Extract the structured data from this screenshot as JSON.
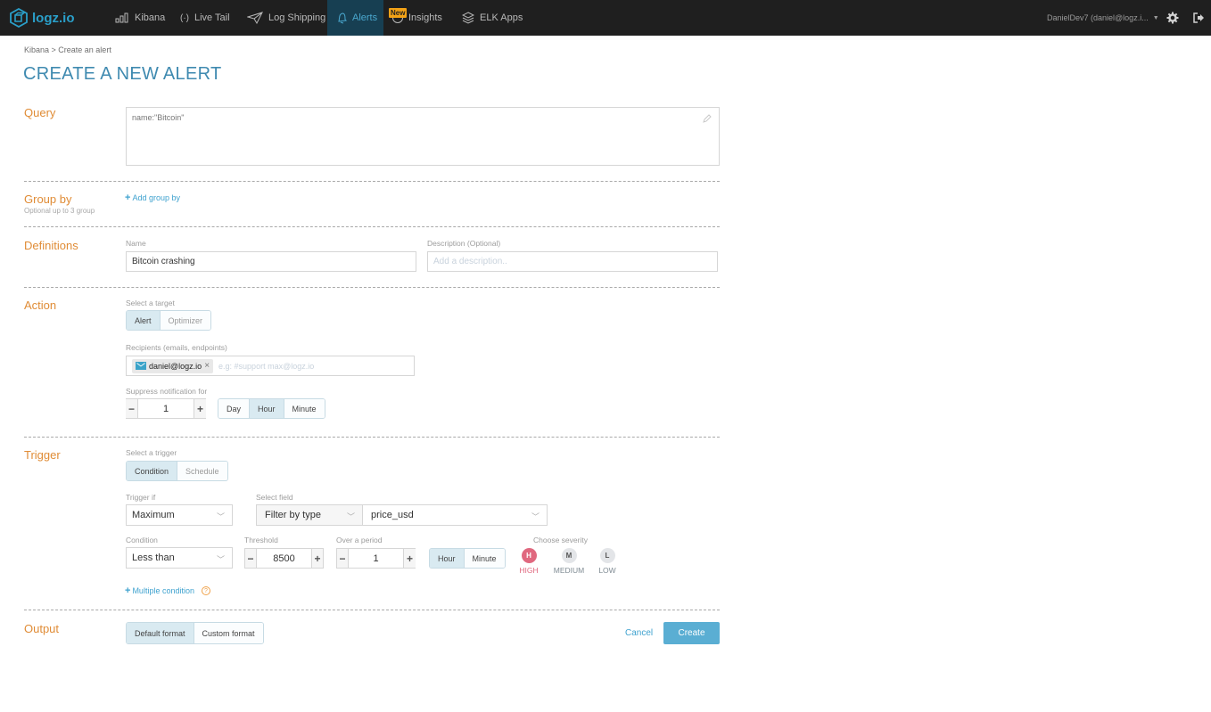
{
  "topbar": {
    "logo_text": "logz.io",
    "nav": [
      {
        "label": "Kibana",
        "icon": "bar-chart-icon"
      },
      {
        "label": "Live Tail",
        "icon": "broadcast-icon"
      },
      {
        "label": "Log Shipping",
        "icon": "paper-plane-icon"
      },
      {
        "label": "Alerts",
        "icon": "bell-icon",
        "active": true
      },
      {
        "label": "Insights",
        "icon": "insights-icon",
        "badge": "New"
      },
      {
        "label": "ELK Apps",
        "icon": "layers-icon"
      }
    ],
    "user_label": "DanielDev7 (daniel@logz.i...",
    "settings_icon": "gear-icon",
    "logout_icon": "logout-icon"
  },
  "breadcrumb": "Kibana > Create an alert",
  "page_title": "CREATE A NEW ALERT",
  "query": {
    "section_title": "Query",
    "value": "name:\"Bitcoin\""
  },
  "group_by": {
    "section_title": "Group by",
    "subtitle": "Optional up to 3 group",
    "add_link": "Add group by"
  },
  "definitions": {
    "section_title": "Definitions",
    "name_label": "Name",
    "name_value": "Bitcoin crashing",
    "description_label": "Description (Optional)",
    "description_placeholder": "Add a description.."
  },
  "action": {
    "section_title": "Action",
    "target_label": "Select a target",
    "targets": [
      "Alert",
      "Optimizer"
    ],
    "target_selected": "Alert",
    "recipients_label": "Recipients (emails, endpoints)",
    "recipients": [
      "daniel@logz.io"
    ],
    "recipients_placeholder": "e.g:  #support  max@logz.io",
    "suppress_label": "Suppress notification for",
    "suppress_value": "1",
    "suppress_units": [
      "Day",
      "Hour",
      "Minute"
    ],
    "suppress_unit_selected": "Hour"
  },
  "trigger": {
    "section_title": "Trigger",
    "trigger_type_label": "Select a trigger",
    "trigger_types": [
      "Condition",
      "Schedule"
    ],
    "trigger_type_selected": "Condition",
    "trigger_if_label": "Trigger if",
    "trigger_if_value": "Maximum",
    "select_field_label": "Select field",
    "filter_type_value": "Filter by type",
    "field_value": "price_usd",
    "condition_label": "Condition",
    "condition_value": "Less than",
    "threshold_label": "Threshold",
    "threshold_value": "8500",
    "period_label": "Over a period",
    "period_value": "1",
    "period_units": [
      "Hour",
      "Minute"
    ],
    "period_unit_selected": "Hour",
    "severity_label": "Choose severity",
    "severities": [
      {
        "letter": "H",
        "label": "HIGH"
      },
      {
        "letter": "M",
        "label": "MEDIUM"
      },
      {
        "letter": "L",
        "label": "LOW"
      }
    ],
    "severity_selected": "HIGH",
    "multiple_condition_link": "Multiple condition"
  },
  "output": {
    "section_title": "Output",
    "formats": [
      "Default format",
      "Custom format"
    ],
    "format_selected": "Default format",
    "cancel_label": "Cancel",
    "create_label": "Create"
  },
  "colors": {
    "accent": "#3f8ab0",
    "section_title": "#e08c36",
    "nav_active_bg": "#173f52",
    "create_button": "#5aaed3",
    "severity_high": "#e0687f",
    "badge_new": "#f3a216"
  }
}
